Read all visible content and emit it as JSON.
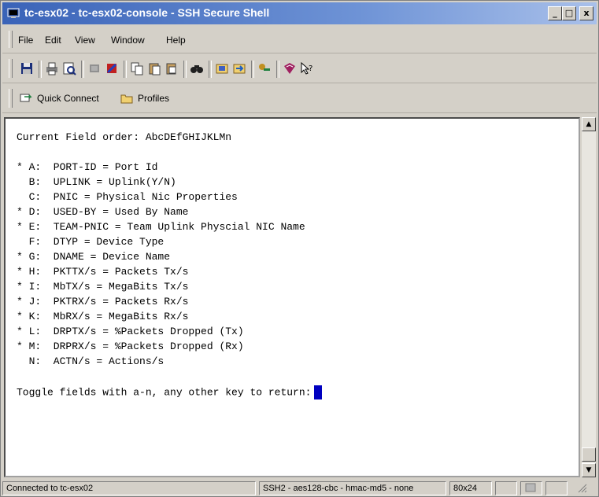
{
  "window": {
    "title": "tc-esx02 - tc-esx02-console - SSH Secure Shell",
    "controls": {
      "minimize": "_",
      "maximize": "□",
      "close": "x"
    }
  },
  "menubar": {
    "items": [
      "File",
      "Edit",
      "View",
      "Window",
      "Help"
    ]
  },
  "toolbar": {
    "icons": [
      "save-icon",
      "print-icon",
      "print-preview-icon",
      "disconnect-icon",
      "settings-icon",
      "copy-icon",
      "paste-icon",
      "paste-alt-icon",
      "find-icon",
      "new-terminal-icon",
      "new-file-transfer-icon",
      "key-icon",
      "help-book-icon",
      "context-help-icon"
    ]
  },
  "quickbar": {
    "quick_connect": "Quick Connect",
    "profiles": "Profiles"
  },
  "terminal": {
    "lines": [
      "Current Field order: AbcDEfGHIJKLMn",
      "",
      "* A:  PORT-ID = Port Id",
      "  B:  UPLINK = Uplink(Y/N)",
      "  C:  PNIC = Physical Nic Properties",
      "* D:  USED-BY = Used By Name",
      "* E:  TEAM-PNIC = Team Uplink Physcial NIC Name",
      "  F:  DTYP = Device Type",
      "* G:  DNAME = Device Name",
      "* H:  PKTTX/s = Packets Tx/s",
      "* I:  MbTX/s = MegaBits Tx/s",
      "* J:  PKTRX/s = Packets Rx/s",
      "* K:  MbRX/s = MegaBits Rx/s",
      "* L:  DRPTX/s = %Packets Dropped (Tx)",
      "* M:  DRPRX/s = %Packets Dropped (Rx)",
      "  N:  ACTN/s = Actions/s",
      "",
      "Toggle fields with a-n, any other key to return:"
    ]
  },
  "statusbar": {
    "connection": "Connected to tc-esx02",
    "cipher": "SSH2 - aes128-cbc - hmac-md5 - none",
    "size": "80x24"
  },
  "colors": {
    "title_gradient_start": "#3a63b8",
    "title_gradient_end": "#a9c0ea",
    "cursor": "#0000c0",
    "chrome": "#d4d0c8"
  }
}
